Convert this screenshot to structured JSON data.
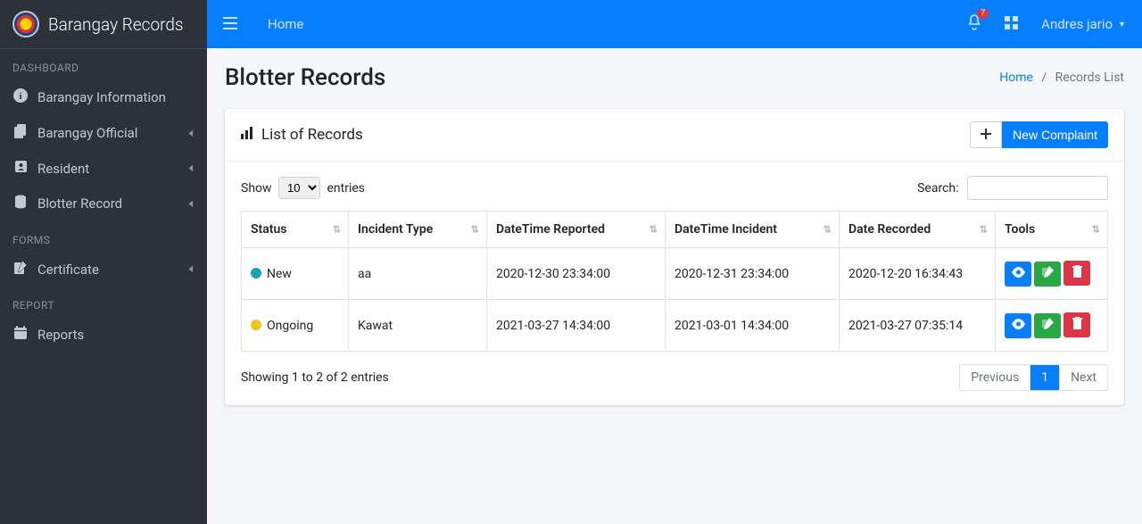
{
  "brand": {
    "name": "Barangay Records"
  },
  "sidebar": {
    "sections": {
      "dashboard": "DASHBOARD",
      "forms": "FORMS",
      "report": "REPORT"
    },
    "items": {
      "info": "Barangay Information",
      "official": "Barangay Official",
      "resident": "Resident",
      "blotter": "Blotter Record",
      "certificate": "Certificate",
      "reports": "Reports"
    }
  },
  "topbar": {
    "home": "Home",
    "notif_count": "7",
    "user_name": "Andres jario"
  },
  "page": {
    "title": "Blotter Records",
    "breadcrumb_home": "Home",
    "breadcrumb_sep": "/",
    "breadcrumb_current": "Records List"
  },
  "card": {
    "title": "List of Records",
    "new_btn": "New Complaint"
  },
  "datatable": {
    "show_prefix": "Show",
    "show_suffix": "entries",
    "page_size": "10",
    "search_label": "Search:",
    "columns": {
      "status": "Status",
      "incident_type": "Incident Type",
      "dt_reported": "DateTime Reported",
      "dt_incident": "DateTime Incident",
      "date_recorded": "Date Recorded",
      "tools": "Tools"
    },
    "rows": [
      {
        "status_class": "new",
        "status": "New",
        "incident_type": "aa",
        "dt_reported": "2020-12-30 23:34:00",
        "dt_incident": "2020-12-31 23:34:00",
        "date_recorded": "2020-12-20 16:34:43"
      },
      {
        "status_class": "ongoing",
        "status": "Ongoing",
        "incident_type": "Kawat",
        "dt_reported": "2021-03-27 14:34:00",
        "dt_incident": "2021-03-01 14:34:00",
        "date_recorded": "2021-03-27 07:35:14"
      }
    ],
    "info": "Showing 1 to 2 of 2 entries",
    "prev": "Previous",
    "page_1": "1",
    "next": "Next"
  }
}
